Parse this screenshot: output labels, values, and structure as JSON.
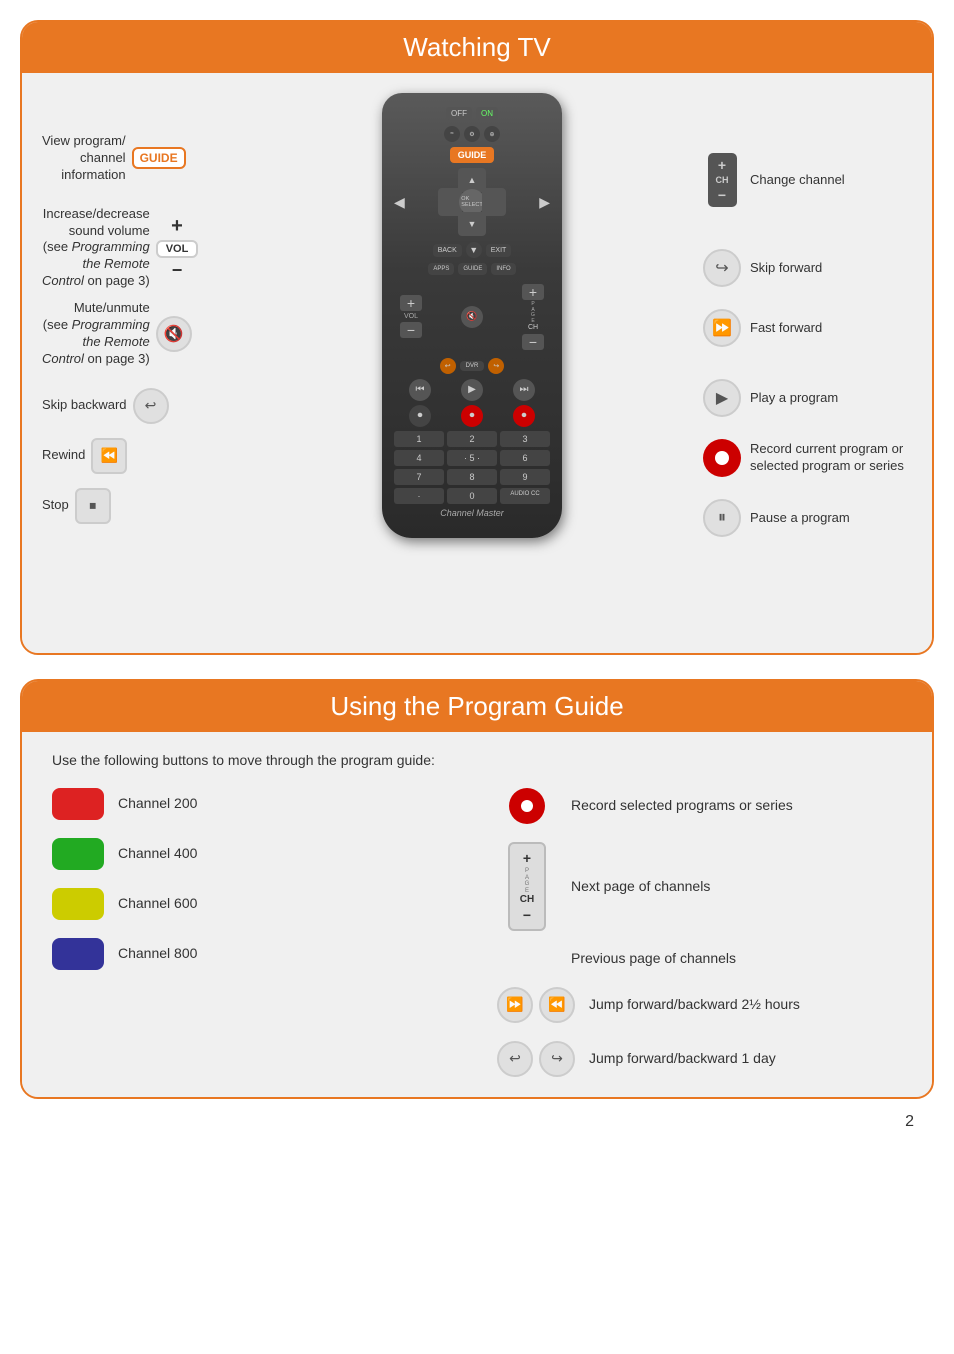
{
  "section1": {
    "title": "Watching TV",
    "left_labels": [
      {
        "id": "view-program",
        "text": "View program/ channel information",
        "badge": "GUIDE",
        "badge_style": "orange"
      },
      {
        "id": "volume",
        "text": "Increase/decrease sound volume (see Programming the Remote Control on page 3)",
        "badge": "VOL",
        "badge_style": "plain"
      },
      {
        "id": "mute",
        "text": "Mute/unmute (see Programming the Remote Control on page 3)",
        "badge": "mute",
        "badge_style": "icon"
      },
      {
        "id": "skip-back",
        "text": "Skip backward",
        "badge": "skip_back",
        "badge_style": "icon"
      },
      {
        "id": "rewind",
        "text": "Rewind",
        "badge": "rewind",
        "badge_style": "icon"
      },
      {
        "id": "stop",
        "text": "Stop",
        "badge": "stop",
        "badge_style": "icon"
      }
    ],
    "right_labels": [
      {
        "id": "change-channel",
        "text": "Change channel",
        "icon": "CH+/-"
      },
      {
        "id": "skip-forward",
        "text": "Skip forward",
        "icon": "skip_fwd"
      },
      {
        "id": "fast-forward",
        "text": "Fast forward",
        "icon": "ff"
      },
      {
        "id": "play",
        "text": "Play a program",
        "icon": "play"
      },
      {
        "id": "record",
        "text": "Record current program or selected program or series",
        "icon": "record"
      },
      {
        "id": "pause",
        "text": "Pause a program",
        "icon": "pause"
      }
    ],
    "remote": {
      "brand": "Channel Master",
      "off_label": "OFF",
      "on_label": "ON"
    }
  },
  "section2": {
    "title": "Using the Program Guide",
    "intro": "Use the following buttons to move through the program guide:",
    "left_items": [
      {
        "id": "ch200",
        "color": "red",
        "text": "Channel 200"
      },
      {
        "id": "ch400",
        "color": "green",
        "text": "Channel 400"
      },
      {
        "id": "ch600",
        "color": "yellow",
        "text": "Channel 600"
      },
      {
        "id": "ch800",
        "color": "blue",
        "text": "Channel 800"
      }
    ],
    "right_items": [
      {
        "id": "record-selected",
        "icon": "record",
        "text": "Record selected programs or series"
      },
      {
        "id": "next-page",
        "icon": "ch-up",
        "text": "Next page of channels"
      },
      {
        "id": "prev-page",
        "icon": "ch-down",
        "text": "Previous page of channels"
      },
      {
        "id": "jump-fwd-back",
        "icon": "jump-fwd-back",
        "text": "Jump forward/backward 2½ hours"
      },
      {
        "id": "jump-day",
        "icon": "jump-day",
        "text": "Jump forward/backward 1 day"
      }
    ]
  },
  "page_number": "2"
}
